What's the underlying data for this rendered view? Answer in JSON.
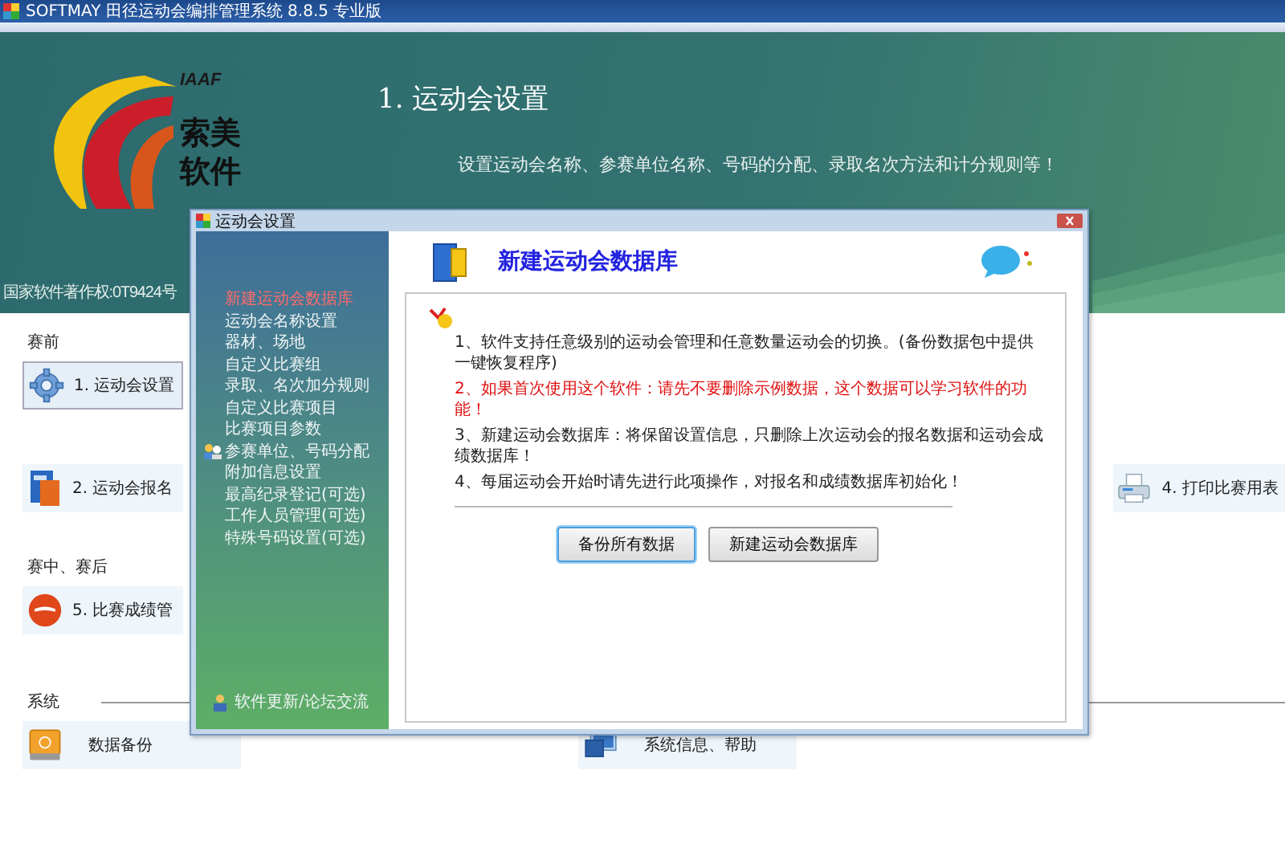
{
  "window": {
    "title": "SOFTMAY 田径运动会编排管理系统 8.8.5  专业版"
  },
  "banner": {
    "logo_mark": "IAAF",
    "logo_name_1": "索美",
    "logo_name_2": "软件",
    "heading": "1. 运动会设置",
    "subtitle": "设置运动会名称、参赛单位名称、号码的分配、录取名次方法和计分规则等！",
    "copyright": "国家软件著作权:0T9424号"
  },
  "sections": [
    {
      "title": "赛前",
      "rows": [
        [
          {
            "label": "1. 运动会设置",
            "kind": "gear",
            "selected": true
          }
        ],
        [
          {
            "label": "2. 运动会报名",
            "kind": "book",
            "selected": false
          },
          {
            "label": "4. 打印比赛用表",
            "kind": "printer",
            "selected": false
          }
        ]
      ]
    },
    {
      "title": "赛中、赛后",
      "rows": [
        [
          {
            "label": "5. 比赛成绩管",
            "kind": "disc",
            "selected": false
          }
        ]
      ]
    },
    {
      "title": "系统",
      "rows": [
        [
          {
            "label": "数据备份",
            "kind": "drive",
            "selected": false
          },
          {
            "label": "系统信息、帮助",
            "kind": "monitor",
            "selected": false
          }
        ]
      ]
    }
  ],
  "dialog": {
    "title": "运动会设置",
    "sidebar": [
      {
        "label": "新建运动会数据库",
        "selected": true,
        "icon": false
      },
      {
        "label": "运动会名称设置",
        "selected": false,
        "icon": false
      },
      {
        "label": "器材、场地",
        "selected": false,
        "icon": false
      },
      {
        "label": "自定义比赛组",
        "selected": false,
        "icon": false
      },
      {
        "label": "录取、名次加分规则",
        "selected": false,
        "icon": false
      },
      {
        "label": "自定义比赛项目",
        "selected": false,
        "icon": false
      },
      {
        "label": "比赛项目参数",
        "selected": false,
        "icon": false
      },
      {
        "label": "参赛单位、号码分配",
        "selected": false,
        "icon": true
      },
      {
        "label": "附加信息设置",
        "selected": false,
        "icon": false
      },
      {
        "label": "最高纪录登记(可选)",
        "selected": false,
        "icon": false
      },
      {
        "label": "工作人员管理(可选)",
        "selected": false,
        "icon": false
      },
      {
        "label": "特殊号码设置(可选)",
        "selected": false,
        "icon": false
      }
    ],
    "footer_link": "软件更新/论坛交流",
    "heading": "新建运动会数据库",
    "notes": [
      {
        "text": "1、软件支持任意级别的运动会管理和任意数量运动会的切换。(备份数据包中提供一键恢复程序)",
        "kind": "normal"
      },
      {
        "text": "2、如果首次使用这个软件：请先不要删除示例数据，这个数据可以学习软件的功能！",
        "kind": "warning"
      },
      {
        "text": "3、新建运动会数据库：将保留设置信息，只删除上次运动会的报名数据和运动会成绩数据库！",
        "kind": "normal"
      },
      {
        "text": "4、每届运动会开始时请先进行此项操作，对报名和成绩数据库初始化！",
        "kind": "normal"
      }
    ],
    "buttons": [
      {
        "label": "备份所有数据",
        "selected": true
      },
      {
        "label": "新建运动会数据库",
        "selected": false
      }
    ]
  }
}
